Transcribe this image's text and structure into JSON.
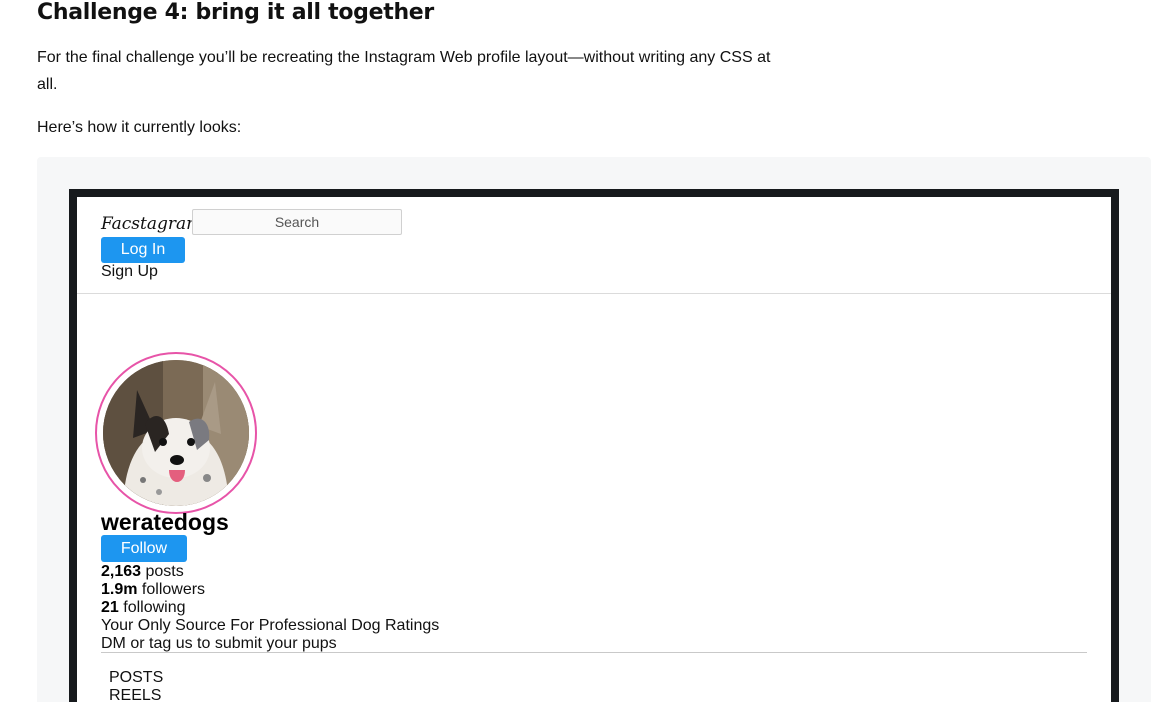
{
  "article": {
    "title": "Challenge 4: bring it all together",
    "intro": "For the final challenge you’ll be recreating the Instagram Web profile layout—without writing any CSS at all.",
    "current_label": "Here’s how it currently looks:"
  },
  "demo": {
    "header": {
      "logo": "Facstagram",
      "search_placeholder": "Search",
      "login_label": "Log In",
      "signup_label": "Sign Up"
    },
    "profile": {
      "username": "weratedogs",
      "follow_label": "Follow",
      "stats": [
        {
          "value": "2,163",
          "label": "posts"
        },
        {
          "value": "1.9m",
          "label": "followers"
        },
        {
          "value": "21",
          "label": "following"
        }
      ],
      "bio": [
        "Your Only Source For Professional Dog Ratings",
        "DM or tag us to submit your pups"
      ]
    },
    "tabs": [
      "POSTS",
      "REELS"
    ]
  },
  "colors": {
    "accent_blue": "#1d96f0",
    "avatar_ring": "#e754a8",
    "frame": "#171a1d"
  }
}
